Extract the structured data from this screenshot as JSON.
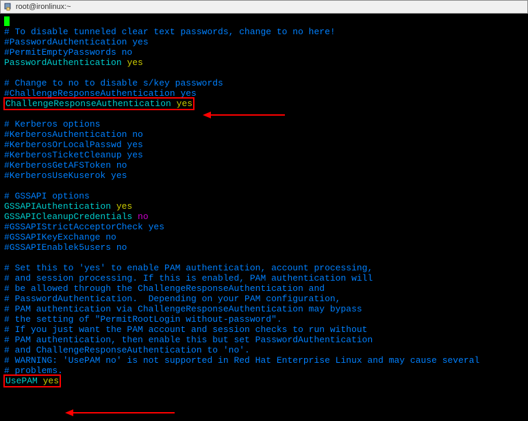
{
  "window": {
    "title": "root@ironlinux:~"
  },
  "lines": {
    "l1": "# To disable tunneled clear text passwords, change to no here!",
    "l2": "#PasswordAuthentication yes",
    "l3": "#PermitEmptyPasswords no",
    "l4k": "PasswordAuthentication ",
    "l4v": "yes",
    "l5": "# Change to no to disable s/key passwords",
    "l6": "#ChallengeResponseAuthentication yes",
    "l7k": "ChallengeResponseAuthentication ",
    "l7v": "yes",
    "l8": "# Kerberos options",
    "l9": "#KerberosAuthentication no",
    "l10": "#KerberosOrLocalPasswd yes",
    "l11": "#KerberosTicketCleanup yes",
    "l12": "#KerberosGetAFSToken no",
    "l13": "#KerberosUseKuserok yes",
    "l14": "# GSSAPI options",
    "l15k": "GSSAPIAuthentication ",
    "l15v": "yes",
    "l16k": "GSSAPICleanupCredentials ",
    "l16v": "no",
    "l17": "#GSSAPIStrictAcceptorCheck yes",
    "l18": "#GSSAPIKeyExchange no",
    "l19": "#GSSAPIEnablek5users no",
    "l20": "# Set this to 'yes' to enable PAM authentication, account processing,",
    "l21": "# and session processing. If this is enabled, PAM authentication will",
    "l22": "# be allowed through the ChallengeResponseAuthentication and",
    "l23": "# PasswordAuthentication.  Depending on your PAM configuration,",
    "l24": "# PAM authentication via ChallengeResponseAuthentication may bypass",
    "l25": "# the setting of \"PermitRootLogin without-password\".",
    "l26": "# If you just want the PAM account and session checks to run without",
    "l27": "# PAM authentication, then enable this but set PasswordAuthentication",
    "l28": "# and ChallengeResponseAuthentication to 'no'.",
    "l29": "# WARNING: 'UsePAM no' is not supported in Red Hat Enterprise Linux and may cause several",
    "l30": "# problems.",
    "l31k": "UsePAM ",
    "l31v": "yes"
  }
}
